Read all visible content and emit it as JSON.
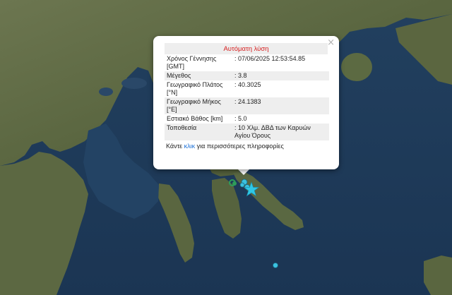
{
  "popup": {
    "title": "Αυτόματη λύση",
    "close_symbol": "×",
    "rows": [
      {
        "label": "Χρόνος Γέννησης [GMT]",
        "value": ": 07/06/2025 12:53:54.85"
      },
      {
        "label": "Μέγεθος",
        "value": ": 3.8"
      },
      {
        "label": "Γεωγραφικό Πλάτος [°N]",
        "value": ": 40.3025"
      },
      {
        "label": "Γεωγραφικό Μήκος [°E]",
        "value": ": 24.1383"
      },
      {
        "label": "Εστιακό Βάθος [km]",
        "value": ": 5.0"
      },
      {
        "label": "Τοποθεσία",
        "value": ": 10 Χλμ. ΔΒΔ των Καρυών Αγίου Όρους"
      }
    ],
    "more_prefix": "Κάντε ",
    "more_link": "κλικ",
    "more_suffix": " για περισσότερες πληροφορίες"
  },
  "markers": {
    "epicenter": {
      "icon": "star-icon",
      "color": "#2fc8e6"
    },
    "quake_color": "#3bc2e0",
    "old_quake_color": "#2e9c5a"
  },
  "colors": {
    "sea": "#1f3a5c",
    "land": "#5f6a44",
    "land_dark": "#4a5634"
  }
}
